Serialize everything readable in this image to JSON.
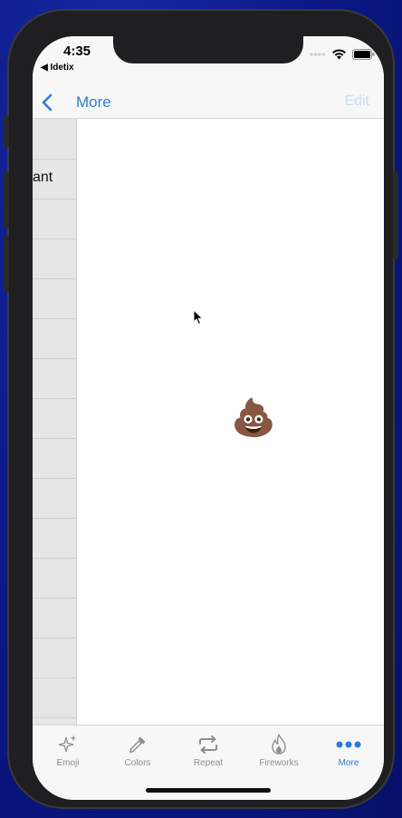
{
  "status": {
    "time": "4:35",
    "back_app": "◀ Idetix"
  },
  "nav": {
    "title": "More",
    "edit": "Edit"
  },
  "side_list": {
    "visible_text": "ant"
  },
  "content": {
    "emoji": "💩"
  },
  "tabs": [
    {
      "label": "Emoji",
      "icon": "sparkles-icon"
    },
    {
      "label": "Colors",
      "icon": "eyedropper-icon"
    },
    {
      "label": "Repeat",
      "icon": "repeat-icon"
    },
    {
      "label": "Fireworks",
      "icon": "flame-icon"
    },
    {
      "label": "More",
      "icon": "more-dots-icon"
    }
  ],
  "colors": {
    "accent": "#2f7bd8",
    "inactive": "#8e8e93"
  }
}
